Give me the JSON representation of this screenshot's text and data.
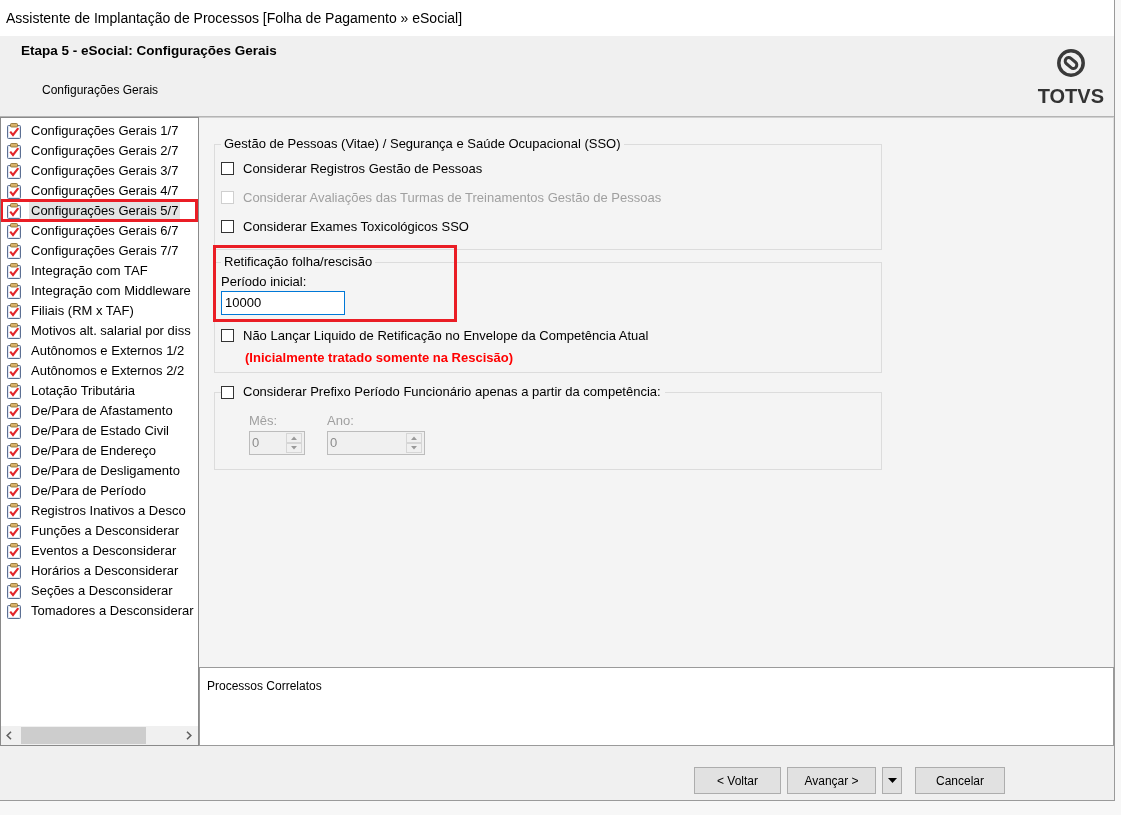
{
  "window": {
    "title": "Assistente de Implantação de Processos [Folha de Pagamento » eSocial]"
  },
  "header": {
    "step_title": "Etapa 5 - eSocial: Configurações Gerais",
    "subtitle": "Configurações Gerais",
    "logo_text": "TOTVS"
  },
  "steps": [
    {
      "label": "Configurações Gerais 1/7",
      "selected": false,
      "highlighted": false
    },
    {
      "label": "Configurações Gerais 2/7",
      "selected": false,
      "highlighted": false
    },
    {
      "label": "Configurações Gerais 3/7",
      "selected": false,
      "highlighted": false
    },
    {
      "label": "Configurações Gerais 4/7",
      "selected": false,
      "highlighted": false
    },
    {
      "label": "Configurações Gerais 5/7",
      "selected": true,
      "highlighted": true
    },
    {
      "label": "Configurações Gerais 6/7",
      "selected": false,
      "highlighted": false
    },
    {
      "label": "Configurações Gerais 7/7",
      "selected": false,
      "highlighted": false
    },
    {
      "label": "Integração com TAF",
      "selected": false,
      "highlighted": false
    },
    {
      "label": "Integração com Middleware",
      "selected": false,
      "highlighted": false
    },
    {
      "label": "Filiais (RM x TAF)",
      "selected": false,
      "highlighted": false
    },
    {
      "label": "Motivos alt. salarial por diss",
      "selected": false,
      "highlighted": false
    },
    {
      "label": "Autônomos e Externos 1/2",
      "selected": false,
      "highlighted": false
    },
    {
      "label": "Autônomos e Externos 2/2",
      "selected": false,
      "highlighted": false
    },
    {
      "label": "Lotação Tributária",
      "selected": false,
      "highlighted": false
    },
    {
      "label": "De/Para de Afastamento",
      "selected": false,
      "highlighted": false
    },
    {
      "label": "De/Para de Estado Civil",
      "selected": false,
      "highlighted": false
    },
    {
      "label": "De/Para de Endereço",
      "selected": false,
      "highlighted": false
    },
    {
      "label": "De/Para de Desligamento",
      "selected": false,
      "highlighted": false
    },
    {
      "label": "De/Para de Período",
      "selected": false,
      "highlighted": false
    },
    {
      "label": "Registros Inativos a Desco",
      "selected": false,
      "highlighted": false
    },
    {
      "label": "Funções a Desconsiderar",
      "selected": false,
      "highlighted": false
    },
    {
      "label": "Eventos a Desconsiderar",
      "selected": false,
      "highlighted": false
    },
    {
      "label": "Horários a Desconsiderar",
      "selected": false,
      "highlighted": false
    },
    {
      "label": "Seções a Desconsiderar",
      "selected": false,
      "highlighted": false
    },
    {
      "label": "Tomadores a Desconsiderar",
      "selected": false,
      "highlighted": false
    }
  ],
  "groups": [
    {
      "kind": "checklist",
      "title": "Gestão de Pessoas (Vitae) / Segurança e Saúde Ocupacional (SSO)",
      "highlighted": false,
      "options": [
        {
          "label": "Considerar Registros Gestão de Pessoas",
          "checked": false,
          "disabled": false
        },
        {
          "label": "Considerar Avaliações das Turmas de Treinamentos Gestão de Pessoas",
          "checked": false,
          "disabled": true
        },
        {
          "label": "Considerar Exames Toxicológicos SSO",
          "checked": false,
          "disabled": false
        }
      ]
    },
    {
      "kind": "field",
      "title": "Retificação folha/rescisão",
      "highlighted": true,
      "field": {
        "label": "Período inicial:",
        "value": "10000",
        "focused": true
      },
      "options": [
        {
          "label": "Não Lançar Liquido de Retificação no Envelope da Competência Atual",
          "checked": false,
          "disabled": false
        }
      ],
      "note": "(Inicialmente tratado somente na Rescisão)"
    },
    {
      "kind": "competence",
      "highlighted": false,
      "toggle": {
        "label": "Considerar Prefixo Período Funcionário apenas a partir da competência:",
        "checked": false
      },
      "spinners": [
        {
          "label": "Mês:",
          "value": "0",
          "disabled": true
        },
        {
          "label": "Ano:",
          "value": "0",
          "disabled": true
        }
      ]
    }
  ],
  "related": {
    "title": "Processos Correlatos"
  },
  "buttons": [
    {
      "kind": "button",
      "label": "< Voltar"
    },
    {
      "kind": "button",
      "label": "Avançar >"
    },
    {
      "kind": "dropdown"
    },
    {
      "kind": "button",
      "label": "Cancelar"
    }
  ]
}
